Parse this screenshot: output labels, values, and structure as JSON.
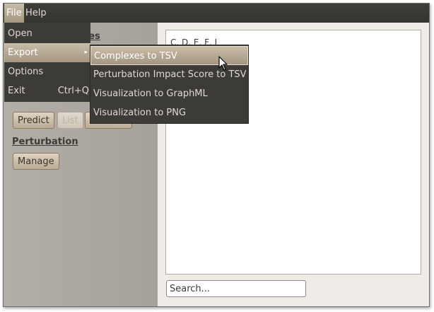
{
  "menubar": {
    "file": "File",
    "help": "Help"
  },
  "file_menu": {
    "items": [
      {
        "label": "Open",
        "shortcut": ""
      },
      {
        "label": "Export",
        "shortcut": "▸"
      },
      {
        "label": "Options",
        "shortcut": ""
      },
      {
        "label": "Exit",
        "shortcut": "Ctrl+Q"
      }
    ]
  },
  "export_submenu": {
    "items": [
      "Complexes to TSV",
      "Perturbation Impact Score to TSV",
      "Visualization to GraphML",
      "Visualization to PNG"
    ]
  },
  "left_panel": {
    "complexes_title_fragment": "exes",
    "predict_label": "Predict",
    "list_label": "List",
    "perturbation_title": "Perturbation",
    "manage_label": "Manage"
  },
  "main": {
    "result_text": "C, D, E, F, I",
    "search_placeholder": "Search..."
  },
  "colors": {
    "menu_bg": "#3c3b37",
    "highlight": "#b3a690",
    "panel_bg": "#aaa69f"
  }
}
